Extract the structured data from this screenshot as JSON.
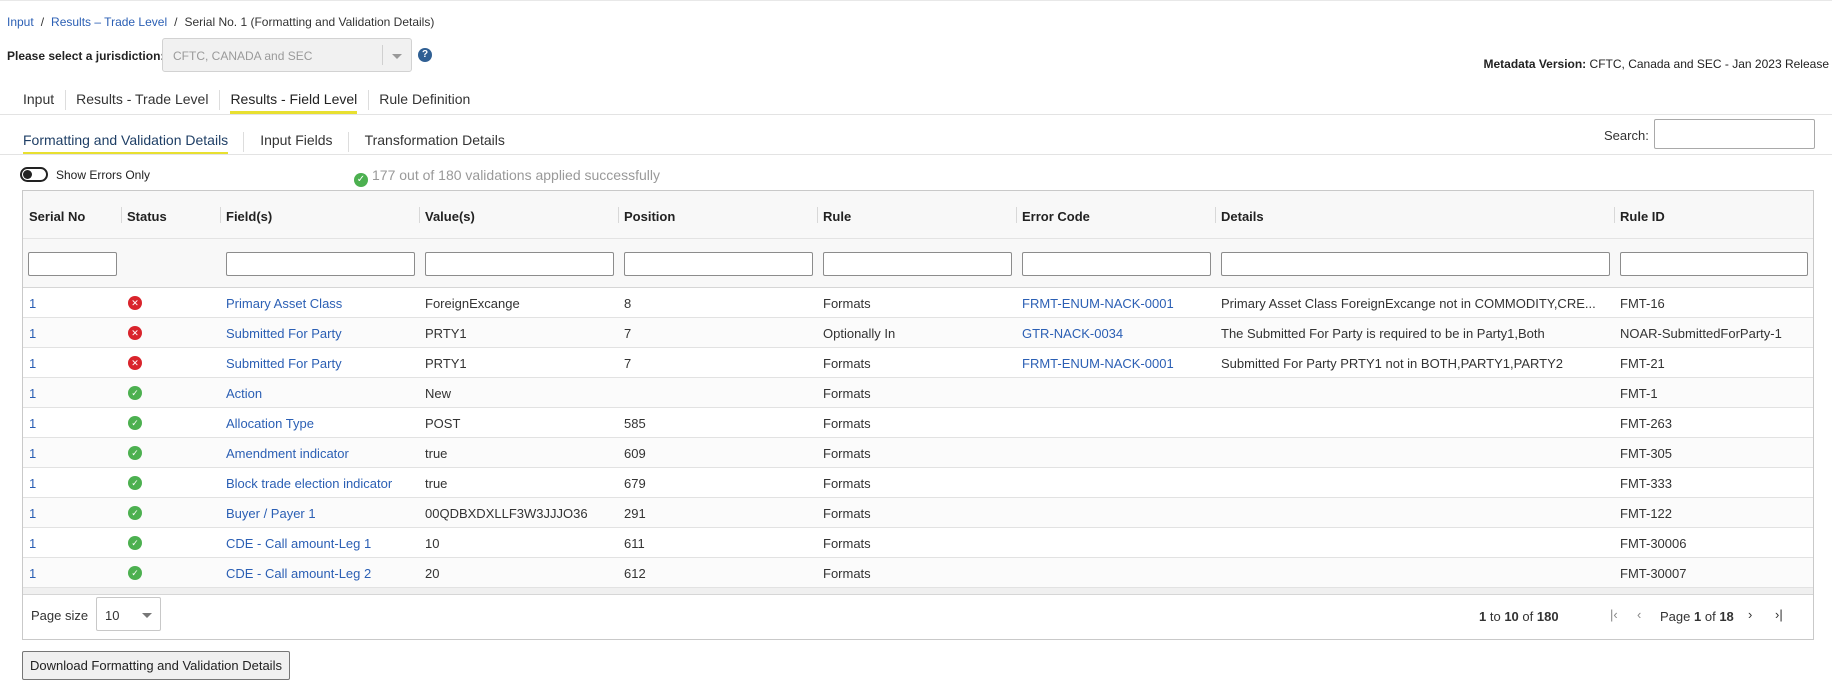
{
  "breadcrumb": {
    "items": [
      {
        "label": "Input",
        "link": true
      },
      {
        "label": "Results – Trade Level",
        "link": true
      },
      {
        "label": "Serial No. 1 (Formatting and Validation Details)",
        "link": false
      }
    ]
  },
  "jurisdiction": {
    "label": "Please select a jurisdiction:",
    "selected": "CFTC, CANADA and SEC",
    "help_icon": "question-circle-icon"
  },
  "metadata": {
    "label": "Metadata Version:",
    "value": "CFTC, Canada and SEC - Jan 2023 Release"
  },
  "main_tabs": [
    {
      "label": "Input",
      "active": false
    },
    {
      "label": "Results - Trade Level",
      "active": false
    },
    {
      "label": "Results - Field Level",
      "active": true
    },
    {
      "label": "Rule Definition",
      "active": false
    }
  ],
  "sub_tabs": [
    {
      "label": "Formatting and Validation Details",
      "active": true
    },
    {
      "label": "Input Fields",
      "active": false
    },
    {
      "label": "Transformation Details",
      "active": false
    }
  ],
  "search": {
    "label": "Search:",
    "value": ""
  },
  "toggle": {
    "label": "Show Errors Only",
    "on": false
  },
  "status_message": "177 out of 180 validations applied successfully",
  "colors": {
    "accent_underline": "#e8e030",
    "link": "#2b5fb4",
    "error": "#d9242c",
    "success": "#4cb050"
  },
  "grid": {
    "columns": [
      "Serial No",
      "Status",
      "Field(s)",
      "Value(s)",
      "Position",
      "Rule",
      "Error Code",
      "Details",
      "Rule ID"
    ],
    "rows": [
      {
        "serial": "1",
        "status": "error",
        "field": "Primary Asset Class",
        "value": "ForeignExcange",
        "position": "8",
        "rule": "Formats",
        "error_code": "FRMT-ENUM-NACK-0001",
        "details": "Primary Asset Class ForeignExcange not in COMMODITY,CRE...",
        "rule_id": "FMT-16"
      },
      {
        "serial": "1",
        "status": "error",
        "field": "Submitted For Party",
        "value": "PRTY1",
        "position": "7",
        "rule": "Optionally In",
        "error_code": "GTR-NACK-0034",
        "details": "The Submitted For Party is required to be in Party1,Both",
        "rule_id": "NOAR-SubmittedForParty-1"
      },
      {
        "serial": "1",
        "status": "error",
        "field": "Submitted For Party",
        "value": "PRTY1",
        "position": "7",
        "rule": "Formats",
        "error_code": "FRMT-ENUM-NACK-0001",
        "details": "Submitted For Party PRTY1 not in BOTH,PARTY1,PARTY2",
        "rule_id": "FMT-21"
      },
      {
        "serial": "1",
        "status": "ok",
        "field": "Action",
        "value": "New",
        "position": "",
        "rule": "Formats",
        "error_code": "",
        "details": "",
        "rule_id": "FMT-1"
      },
      {
        "serial": "1",
        "status": "ok",
        "field": "Allocation Type",
        "value": "POST",
        "position": "585",
        "rule": "Formats",
        "error_code": "",
        "details": "",
        "rule_id": "FMT-263"
      },
      {
        "serial": "1",
        "status": "ok",
        "field": "Amendment indicator",
        "value": "true",
        "position": "609",
        "rule": "Formats",
        "error_code": "",
        "details": "",
        "rule_id": "FMT-305"
      },
      {
        "serial": "1",
        "status": "ok",
        "field": "Block trade election indicator",
        "value": "true",
        "position": "679",
        "rule": "Formats",
        "error_code": "",
        "details": "",
        "rule_id": "FMT-333"
      },
      {
        "serial": "1",
        "status": "ok",
        "field": "Buyer / Payer 1",
        "value": "00QDBXDXLLF3W3JJJO36",
        "position": "291",
        "rule": "Formats",
        "error_code": "",
        "details": "",
        "rule_id": "FMT-122"
      },
      {
        "serial": "1",
        "status": "ok",
        "field": "CDE - Call amount-Leg 1",
        "value": "10",
        "position": "611",
        "rule": "Formats",
        "error_code": "",
        "details": "",
        "rule_id": "FMT-30006"
      },
      {
        "serial": "1",
        "status": "ok",
        "field": "CDE - Call amount-Leg 2",
        "value": "20",
        "position": "612",
        "rule": "Formats",
        "error_code": "",
        "details": "",
        "rule_id": "FMT-30007"
      }
    ]
  },
  "pager": {
    "page_size_label": "Page size",
    "page_size": "10",
    "range_from": "1",
    "range_to": "10",
    "range_of": "of",
    "range_sep": "to",
    "total": "180",
    "page_label": "Page",
    "page": "1",
    "page_of": "of",
    "page_total": "18",
    "first_icon": "first-page-icon",
    "prev_icon": "previous-page-icon",
    "next_icon": "next-page-icon",
    "last_icon": "last-page-icon"
  },
  "download_button": "Download Formatting and Validation Details"
}
